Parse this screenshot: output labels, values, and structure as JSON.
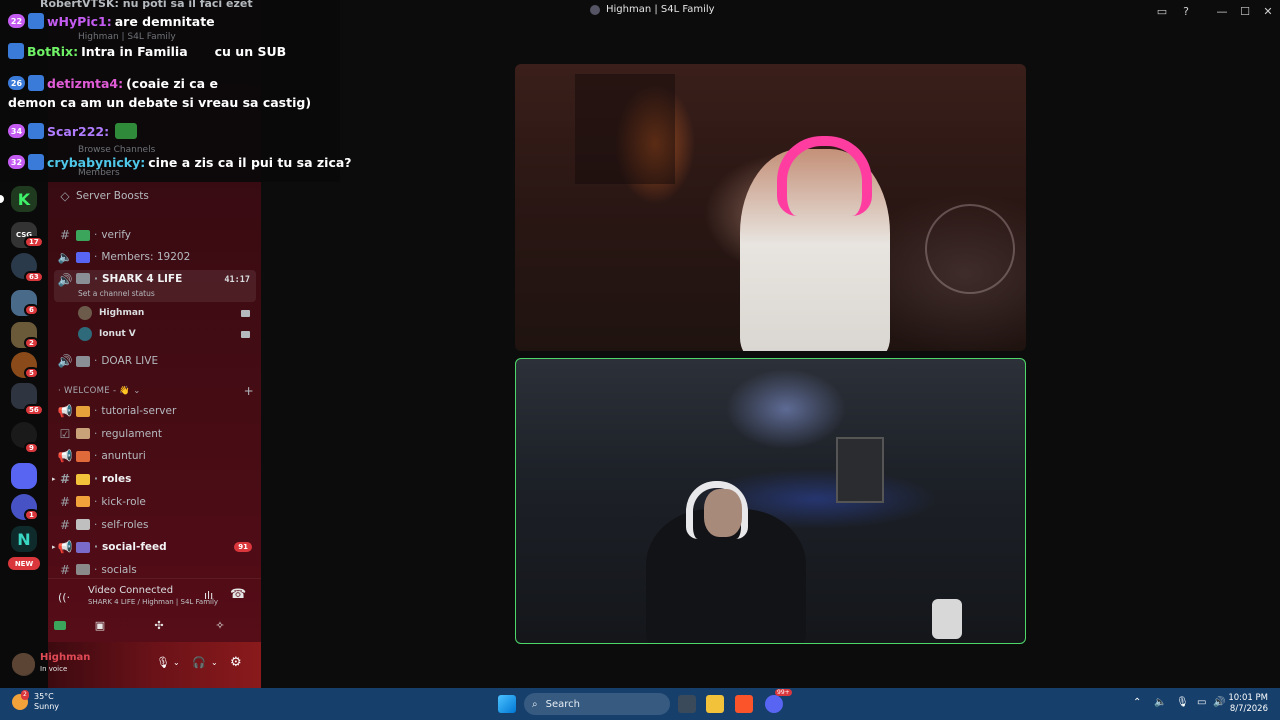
{
  "window": {
    "title": "Highman | S4L Family"
  },
  "chat": {
    "lines": [
      {
        "level": "22",
        "user": "wHyPic1:",
        "user_color": "#c55cf2",
        "message": "are demnitate"
      },
      {
        "level": "",
        "user": "BotRix:",
        "user_color": "#6ff266",
        "message": "Intra in Familia",
        "suffix": "cu un SUB"
      },
      {
        "level": "26",
        "user": "detizmta4:",
        "user_color": "#e05cd6",
        "message": "(coaie zi ca e"
      },
      {
        "level": "",
        "user": "",
        "user_color": "#fff",
        "message": "demon ca am un debate si vreau sa castig)"
      },
      {
        "level": "34",
        "user": "Scar222:",
        "user_color": "#b07cff",
        "message": ""
      },
      {
        "level": "32",
        "user": "crybabynicky:",
        "user_color": "#4fc7e8",
        "message": "cine a zis ca il pui tu sa zica?"
      }
    ],
    "ghost_top": "RobertVTSK: nu poti sa il faci ezet",
    "ghost_server": "Highman | S4L Family",
    "ghost_browse": "Browse Channels",
    "ghost_members": "Members"
  },
  "sidebar": {
    "server_boosts": "Server Boosts",
    "channels_top": [
      {
        "name": "verify",
        "color": "#3ba55c"
      },
      {
        "name": "Members: 19202",
        "color": "#5865f2"
      }
    ],
    "active_channel": {
      "name": "SHARK 4 LIFE",
      "timer": "41:17",
      "status": "Set a channel status"
    },
    "voice_users": [
      {
        "name": "Highman",
        "color": "#6c5b4a"
      },
      {
        "name": "Ionut V",
        "color": "#2e6a7a"
      }
    ],
    "doar_live": "DOAR LIVE",
    "category": "WELCOME - 👋",
    "channels": [
      {
        "name": "tutorial-server",
        "color": "#e8a23a",
        "bold": false,
        "hash": "📢"
      },
      {
        "name": "regulament",
        "color": "#c9a27a",
        "bold": false,
        "hash": "☑"
      },
      {
        "name": "anunturi",
        "color": "#e06a3a",
        "bold": false,
        "hash": "📢"
      },
      {
        "name": "roles",
        "color": "#f2c23a",
        "bold": true,
        "hash": "#"
      },
      {
        "name": "kick-role",
        "color": "#f2a23a",
        "bold": false,
        "hash": "#"
      },
      {
        "name": "self-roles",
        "color": "#bfbfbf",
        "bold": false,
        "hash": "#"
      },
      {
        "name": "social-feed",
        "color": "#7a6ac9",
        "bold": true,
        "hash": "📢",
        "badge": "91"
      },
      {
        "name": "socials",
        "color": "#8a8a8a",
        "bold": false,
        "hash": "#"
      }
    ],
    "voice": {
      "status": "Video Connected",
      "location": "SHARK 4 LIFE / Highman | S4L Family"
    },
    "user": {
      "name": "Highman",
      "status": "In voice"
    }
  },
  "rail": {
    "badges": [
      "17",
      "63",
      "6",
      "2",
      "5",
      "56",
      "9",
      "1"
    ],
    "new_label": "NEW",
    "server_labels": [
      "K",
      "CSG",
      "N"
    ]
  },
  "taskbar": {
    "weather_temp": "35°C",
    "weather_desc": "Sunny",
    "weather_badge": "2",
    "search_label": "Search",
    "time": "10:01 PM",
    "date": "8/7/2026",
    "discord_badge": "99+"
  }
}
